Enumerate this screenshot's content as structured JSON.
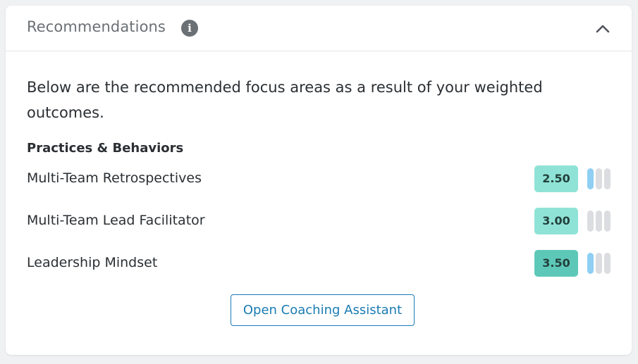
{
  "header": {
    "title": "Recommendations",
    "info_icon": "info-icon",
    "collapse_icon": "chevron-up-icon"
  },
  "intro_text": "Below are the recommended focus areas as a result of your weighted outcomes.",
  "section": {
    "heading": "Practices & Behaviors",
    "items": [
      {
        "label": "Multi-Team Retrospectives",
        "score": "2.50",
        "score_bg": "#8fe3d6",
        "bars_filled": 1,
        "bars_total": 3
      },
      {
        "label": "Multi-Team Lead Facilitator",
        "score": "3.00",
        "score_bg": "#8fe3d6",
        "bars_filled": 0,
        "bars_total": 3
      },
      {
        "label": "Leadership Mindset",
        "score": "3.50",
        "score_bg": "#5ec8b8",
        "bars_filled": 1,
        "bars_total": 3
      }
    ]
  },
  "action": {
    "label": "Open Coaching Assistant"
  },
  "colors": {
    "accent": "#1a7bb3",
    "bar_filled": "#8ecff3",
    "bar_empty": "#dcdde0"
  }
}
